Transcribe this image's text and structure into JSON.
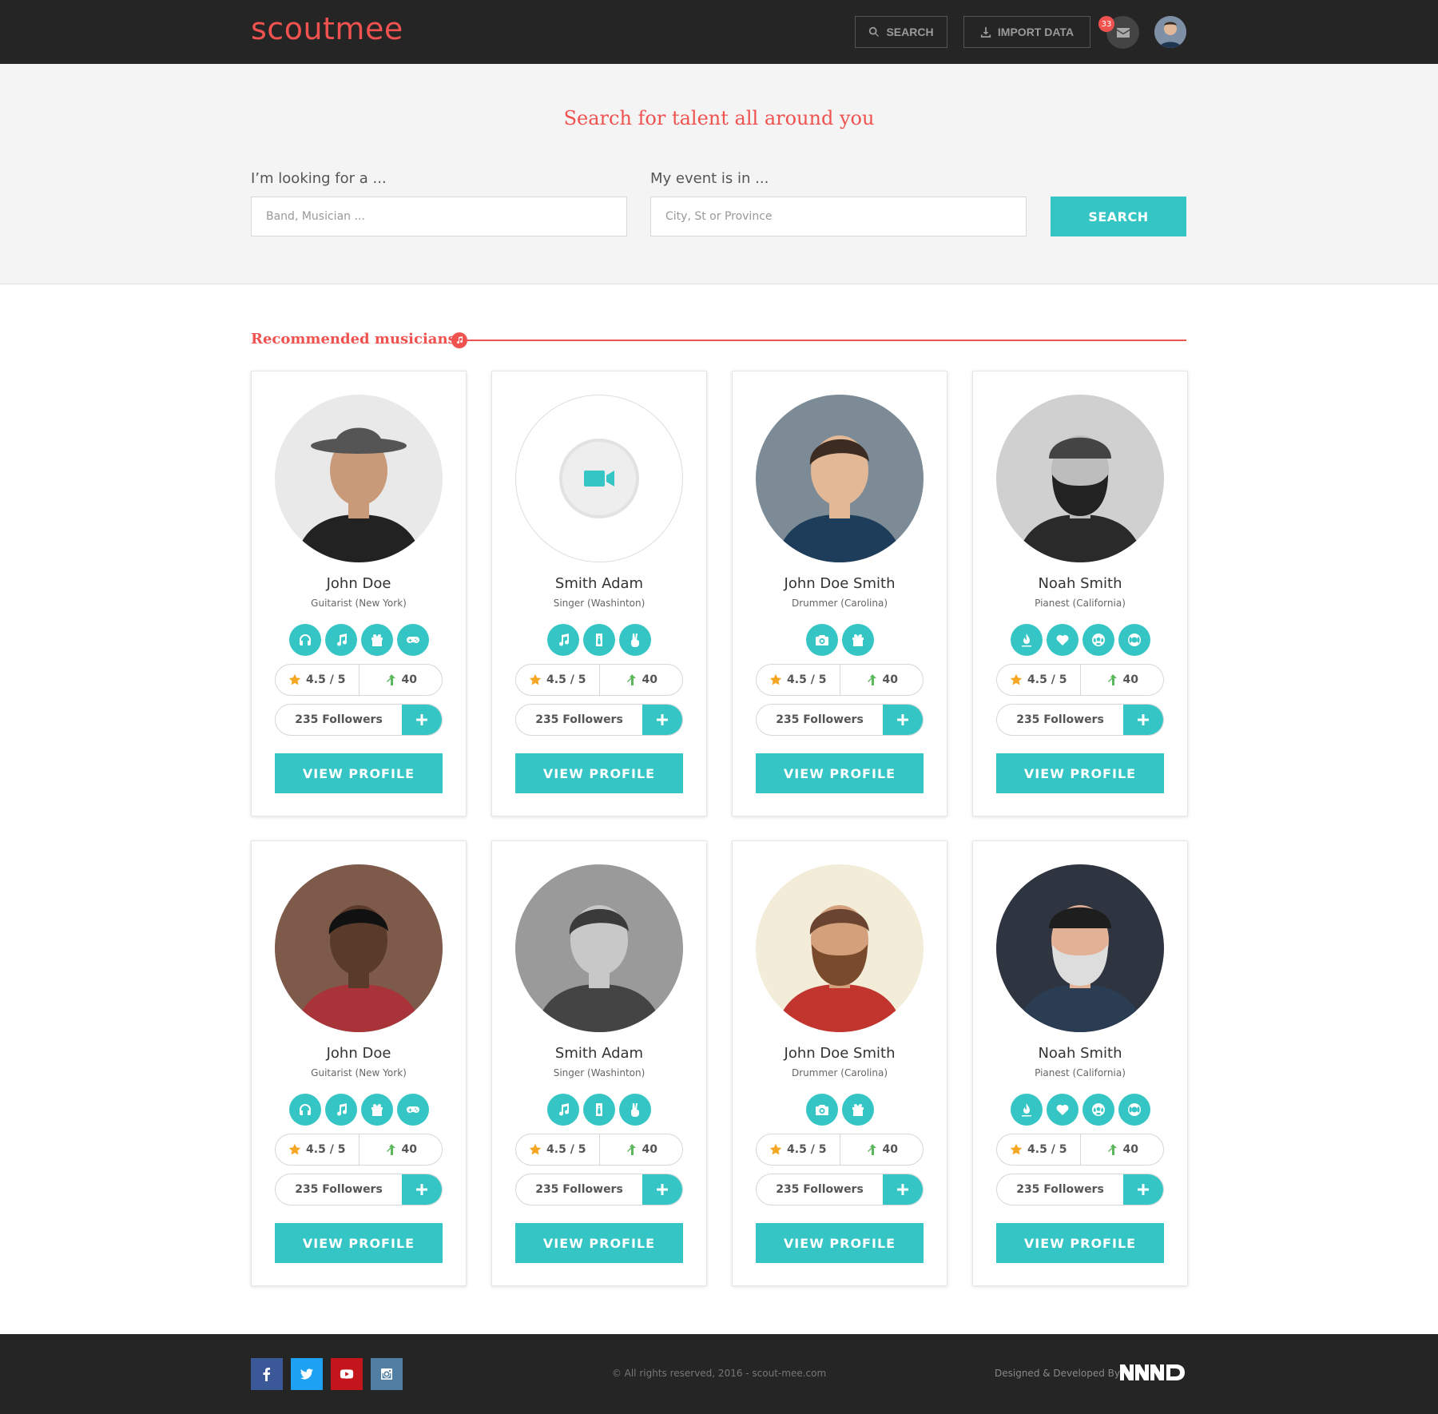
{
  "header": {
    "logo": "scoutmee",
    "search_label": "SEARCH",
    "import_label": "IMPORT DATA",
    "notification_count": "33"
  },
  "hero": {
    "title": "Search for talent all around you",
    "looking_label": "I’m looking for a ...",
    "looking_placeholder": "Band, Musician ...",
    "event_label": "My event is in ...",
    "event_placeholder": "City, St or Province",
    "search_button": "SEARCH"
  },
  "section": {
    "title": "Recommended musicians"
  },
  "cards": [
    {
      "name": "John Doe",
      "role": "Guitarist (New York)",
      "skills": [
        "headphones-icon",
        "music-note-icon",
        "gift-icon",
        "gamepad-icon"
      ],
      "rating": "4.5 / 5",
      "trend": "40",
      "followers": "235 Followers",
      "button": "VIEW PROFILE"
    },
    {
      "name": "Smith Adam",
      "role": "Singer (Washinton)",
      "skills": [
        "music-note-icon",
        "tie-icon",
        "peace-hand-icon"
      ],
      "rating": "4.5 / 5",
      "trend": "40",
      "followers": "235 Followers",
      "button": "VIEW PROFILE"
    },
    {
      "name": "John Doe Smith",
      "role": "Drummer (Carolina)",
      "skills": [
        "camera-icon",
        "gift-icon"
      ],
      "rating": "4.5 / 5",
      "trend": "40",
      "followers": "235 Followers",
      "button": "VIEW PROFILE"
    },
    {
      "name": "Noah Smith",
      "role": "Pianest (California)",
      "skills": [
        "fire-icon",
        "heart-icon",
        "soccer-ball-icon",
        "life-ring-icon"
      ],
      "rating": "4.5 / 5",
      "trend": "40",
      "followers": "235 Followers",
      "button": "VIEW PROFILE"
    },
    {
      "name": "John Doe",
      "role": "Guitarist (New York)",
      "skills": [
        "headphones-icon",
        "music-note-icon",
        "gift-icon",
        "gamepad-icon"
      ],
      "rating": "4.5 / 5",
      "trend": "40",
      "followers": "235 Followers",
      "button": "VIEW PROFILE"
    },
    {
      "name": "Smith Adam",
      "role": "Singer (Washinton)",
      "skills": [
        "music-note-icon",
        "tie-icon",
        "peace-hand-icon"
      ],
      "rating": "4.5 / 5",
      "trend": "40",
      "followers": "235 Followers",
      "button": "VIEW PROFILE"
    },
    {
      "name": "John Doe Smith",
      "role": "Drummer (Carolina)",
      "skills": [
        "camera-icon",
        "gift-icon"
      ],
      "rating": "4.5 / 5",
      "trend": "40",
      "followers": "235 Followers",
      "button": "VIEW PROFILE"
    },
    {
      "name": "Noah Smith",
      "role": "Pianest (California)",
      "skills": [
        "fire-icon",
        "heart-icon",
        "soccer-ball-icon",
        "life-ring-icon"
      ],
      "rating": "4.5 / 5",
      "trend": "40",
      "followers": "235 Followers",
      "button": "VIEW PROFILE"
    }
  ],
  "footer": {
    "copyright": "© All rights reserved, 2016 - scout-mee.com",
    "credit": "Designed & Developed By:",
    "social": [
      "facebook-icon",
      "twitter-icon",
      "youtube-icon",
      "instagram-icon"
    ]
  },
  "colors": {
    "accent": "#35c5c5",
    "brand": "#f0524f",
    "dark": "#252525",
    "star": "#f5a623",
    "trend": "#5cb85c"
  }
}
